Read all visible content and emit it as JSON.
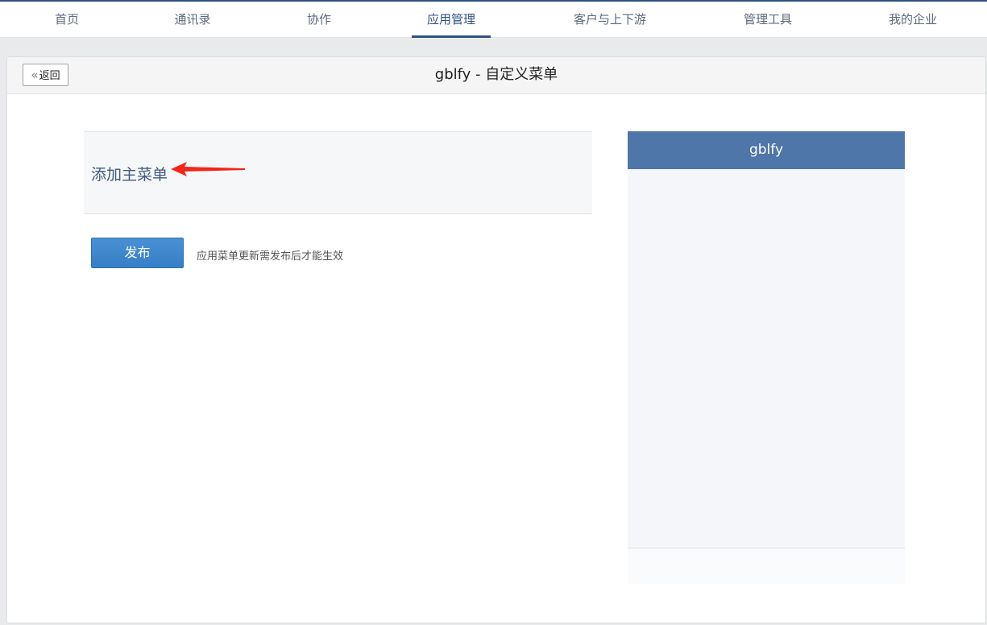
{
  "nav": {
    "items": [
      {
        "label": "首页"
      },
      {
        "label": "通讯录"
      },
      {
        "label": "协作"
      },
      {
        "label": "应用管理",
        "active": true
      },
      {
        "label": "客户与上下游"
      },
      {
        "label": "管理工具"
      },
      {
        "label": "我的企业"
      }
    ]
  },
  "header": {
    "back_label": "返回",
    "back_icon": "double-chevron-left",
    "title": "gblfy - 自定义菜单"
  },
  "menu": {
    "add_main_label": "添加主菜单"
  },
  "publish": {
    "button_label": "发布",
    "hint": "应用菜单更新需发布后才能生效"
  },
  "preview": {
    "app_name": "gblfy"
  },
  "colors": {
    "accent": "#2f5282",
    "phone_header": "#4f76a8",
    "publish_button": "#3e88cd",
    "annotation_arrow": "#f2261b"
  }
}
